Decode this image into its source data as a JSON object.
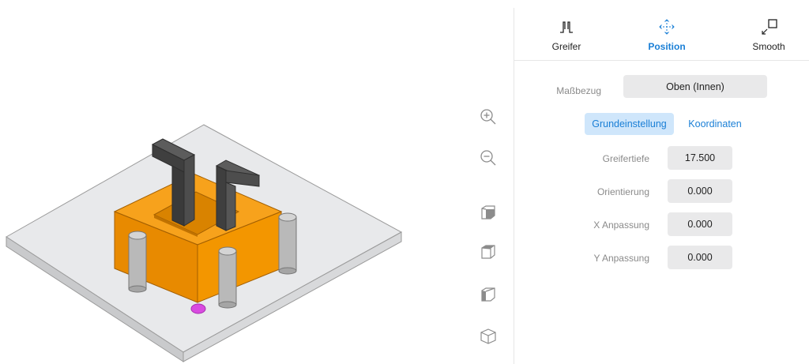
{
  "tabs": [
    {
      "label": "Greifer",
      "icon": "gripper-icon",
      "active": false
    },
    {
      "label": "Position",
      "icon": "move-icon",
      "active": true
    },
    {
      "label": "Smooth",
      "icon": "smooth-icon",
      "active": false
    }
  ],
  "massbezug": {
    "label": "Maßbezug",
    "value": "Oben (Innen)"
  },
  "segments": {
    "basic": "Grundeinstellung",
    "coords": "Koordinaten",
    "active": "basic"
  },
  "fields": {
    "greifertiefe": {
      "label": "Greifertiefe",
      "value": "17.500"
    },
    "orientierung": {
      "label": "Orientierung",
      "value": "0.000"
    },
    "x_anpassung": {
      "label": "X Anpassung",
      "value": "0.000"
    },
    "y_anpassung": {
      "label": "Y Anpassung",
      "value": "0.000"
    }
  },
  "view_tools": [
    "zoom-in-icon",
    "zoom-out-icon",
    "view-cube-front-icon",
    "view-cube-top-icon",
    "view-cube-side-icon",
    "view-cube-iso-icon"
  ],
  "colors": {
    "accent": "#1a7fd6",
    "part": "#f29400",
    "gripper": "#4a4a4a",
    "pin": "#b9b9b9",
    "plate": "#e8e9eb",
    "marker": "#d94be0"
  }
}
